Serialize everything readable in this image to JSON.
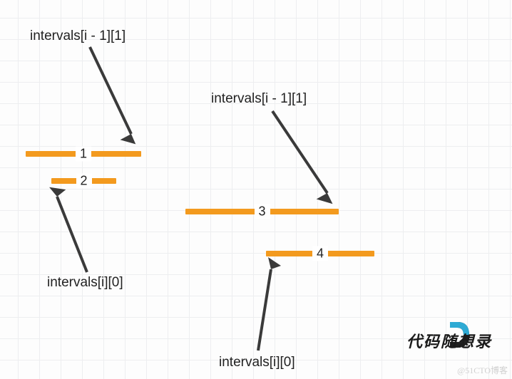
{
  "labels": {
    "top_left": "intervals[i - 1][1]",
    "top_right": "intervals[i - 1][1]",
    "bottom_left": "intervals[i][0]",
    "bottom_right": "intervals[i][0]"
  },
  "intervals": [
    {
      "id": 1,
      "num": "1"
    },
    {
      "id": 2,
      "num": "2"
    },
    {
      "id": 3,
      "num": "3"
    },
    {
      "id": 4,
      "num": "4"
    }
  ],
  "watermark": {
    "text": "代码随想录",
    "cto": "@51CTO博客"
  }
}
